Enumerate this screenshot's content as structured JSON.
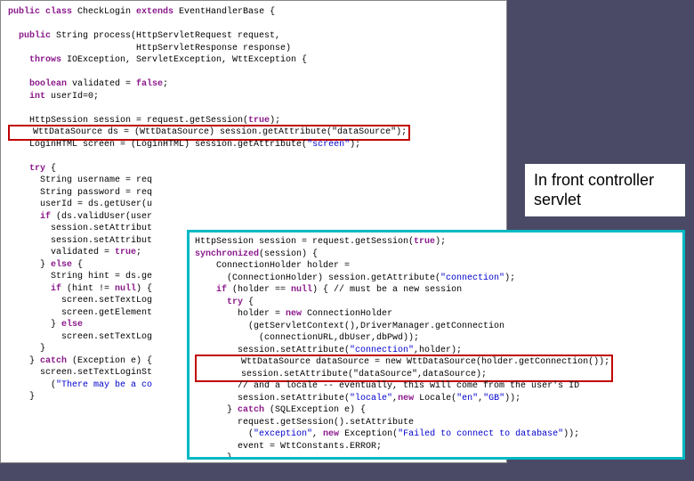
{
  "annotation": {
    "text": "In front controller servlet"
  },
  "back_code": {
    "line1_a": "public class",
    "line1_b": " CheckLogin ",
    "line1_c": "extends",
    "line1_d": " EventHandlerBase {",
    "line2_a": "  public",
    "line2_b": " String process(HttpServletRequest request,",
    "line3": "                        HttpServletResponse response)",
    "line4_a": "    throws",
    "line4_b": " IOException, ServletException, WttException {",
    "line5_a": "    boolean",
    "line5_b": " validated = ",
    "line5_c": "false",
    "line5_d": ";",
    "line6_a": "    int",
    "line6_b": " userId=0;",
    "line7": "    HttpSession session = request.getSession(",
    "line7_b": "true",
    "line7_c": ");",
    "line8": "    WttDataSource ds = (WttDataSource) session.getAttribute(\"dataSource\");",
    "line9": "    LoginHTML screen = (LoginHTML) session.getAttribute(",
    "line9_b": "\"screen\"",
    "line9_c": ");",
    "line10_a": "    try",
    "line10_b": " {",
    "line11": "      String username = req",
    "line12": "      String password = req",
    "line13": "      userId = ds.getUser(u",
    "line14_a": "      if",
    "line14_b": " (ds.validUser(user",
    "line15": "        session.setAttribut",
    "line16": "        session.setAttribut",
    "line17": "        validated = ",
    "line17_b": "true",
    "line17_c": ";",
    "line18_a": "      } ",
    "line18_b": "else",
    "line18_c": " {",
    "line19": "        String hint = ds.ge",
    "line20_a": "        if",
    "line20_b": " (hint != ",
    "line20_c": "null",
    "line20_d": ") {",
    "line21": "          screen.setTextLog",
    "line22": "          screen.getElement",
    "line23_a": "        } ",
    "line23_b": "else",
    "line24": "          screen.setTextLog",
    "line25": "      }",
    "line26_a": "    } ",
    "line26_b": "catch",
    "line26_c": " (Exception e) {",
    "line27": "      screen.setTextLoginSt",
    "line28": "        (",
    "line28_b": "\"There may be a co",
    "line29": "    }"
  },
  "front_code": {
    "l1": "HttpSession session = request.getSession(",
    "l1b": "true",
    "l1c": ");",
    "l2a": "synchronized",
    "l2b": "(session) {",
    "l3": "    ConnectionHolder holder =",
    "l4": "      (ConnectionHolder) session.getAttribute(",
    "l4b": "\"connection\"",
    "l4c": ");",
    "l5a": "    if",
    "l5b": " (holder == ",
    "l5c": "null",
    "l5d": ") { // must be a new session",
    "l6a": "      try",
    "l6b": " {",
    "l7": "        holder = ",
    "l7b": "new",
    "l7c": " ConnectionHolder",
    "l8": "          (getServletContext(),DriverManager.getConnection",
    "l9": "            (connectionURL,dbUser,dbPwd));",
    "l10": "        session.setAttribute(",
    "l10b": "\"connection\"",
    "l10c": ",holder);",
    "l11": "        WttDataSource dataSource = new WttDataSource(holder.getConnection());",
    "l12": "        session.setAttribute(\"dataSource\",dataSource);",
    "l13": "        // and a locale -- eventually, this will come from the user's ID",
    "l14": "        session.setAttribute(",
    "l14b": "\"locale\"",
    "l14c": ",",
    "l14d": "new",
    "l14e": " Locale(",
    "l14f": "\"en\"",
    "l14g": ",",
    "l14h": "\"GB\"",
    "l14i": "));",
    "l15a": "      } ",
    "l15b": "catch",
    "l15c": " (SQLException e) {",
    "l16": "        request.getSession().setAttribute",
    "l17": "          (",
    "l17b": "\"exception\"",
    "l17c": ", ",
    "l17d": "new",
    "l17e": " Exception(",
    "l17f": "\"Failed to connect to database\"",
    "l17g": "));",
    "l18": "        event = WttConstants.ERROR;",
    "l19": "      }",
    "l20": "    }",
    "l21": "}"
  }
}
